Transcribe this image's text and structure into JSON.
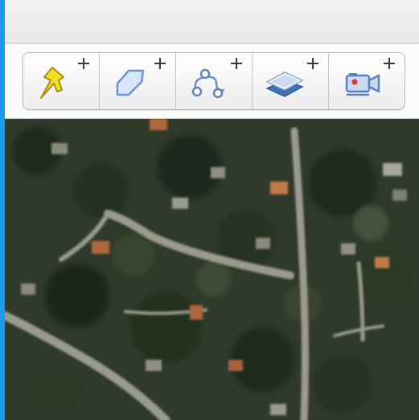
{
  "window": {
    "accent_color": "#1a9be6"
  },
  "toolbar": {
    "buttons": [
      {
        "name": "add-placemark",
        "icon": "pushpin-icon",
        "badge": "plus-icon"
      },
      {
        "name": "add-polygon",
        "icon": "polygon-icon",
        "badge": "plus-icon"
      },
      {
        "name": "add-path",
        "icon": "path-icon",
        "badge": "plus-icon"
      },
      {
        "name": "add-image-overlay",
        "icon": "layers-icon",
        "badge": "plus-icon"
      },
      {
        "name": "record-tour",
        "icon": "camera-icon",
        "badge": "plus-icon"
      }
    ]
  },
  "map": {
    "type": "satellite-imagery",
    "colors": {
      "vegetation": "#2f3a2a",
      "road": "#9a9a8e",
      "roof": "#b0683e"
    }
  }
}
